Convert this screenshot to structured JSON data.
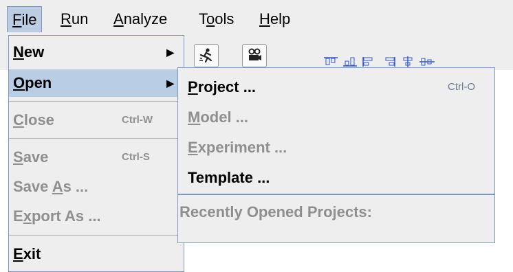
{
  "menubar": {
    "items": [
      {
        "mnemonic": "F",
        "rest": "ile"
      },
      {
        "mnemonic": "R",
        "rest": "un"
      },
      {
        "mnemonic": "A",
        "rest": "nalyze"
      },
      {
        "pre": "T",
        "mnemonic": "o",
        "rest": "ols"
      },
      {
        "mnemonic": "H",
        "rest": "elp"
      }
    ]
  },
  "toolbar": {
    "icons": [
      "runner-icon",
      "camera-icon",
      "align-top-icon",
      "align-bottom-icon",
      "align-left-icon",
      "align-right-icon",
      "align-center-icon",
      "align-middle-icon"
    ]
  },
  "file_menu": {
    "new": {
      "mnemonic": "N",
      "rest": "ew",
      "arrow": "▶"
    },
    "open": {
      "mnemonic": "O",
      "rest": "pen",
      "arrow": "▶"
    },
    "close": {
      "mnemonic": "C",
      "rest": "lose",
      "shortcut": "Ctrl-W"
    },
    "save": {
      "mnemonic": "S",
      "rest": "ave",
      "shortcut": "Ctrl-S"
    },
    "save_as": {
      "pre": "Save ",
      "mnemonic": "A",
      "rest": "s ..."
    },
    "export_as": {
      "pre": "E",
      "mnemonic": "x",
      "rest": "port As ..."
    },
    "exit": {
      "mnemonic": "E",
      "rest": "xit"
    }
  },
  "open_submenu": {
    "project": {
      "mnemonic": "P",
      "rest": "roject ...",
      "shortcut": "Ctrl-O"
    },
    "model": {
      "mnemonic": "M",
      "rest": "odel ..."
    },
    "experiment": {
      "mnemonic": "E",
      "rest": "xperiment ..."
    },
    "template": {
      "label": "Template ..."
    },
    "recent_label": "Recently Opened Projects:"
  },
  "colors": {
    "menu_bg": "#eeeeee",
    "highlight": "#b9cde5",
    "border": "#7b98bf",
    "disabled_text": "#8f8f8f"
  }
}
